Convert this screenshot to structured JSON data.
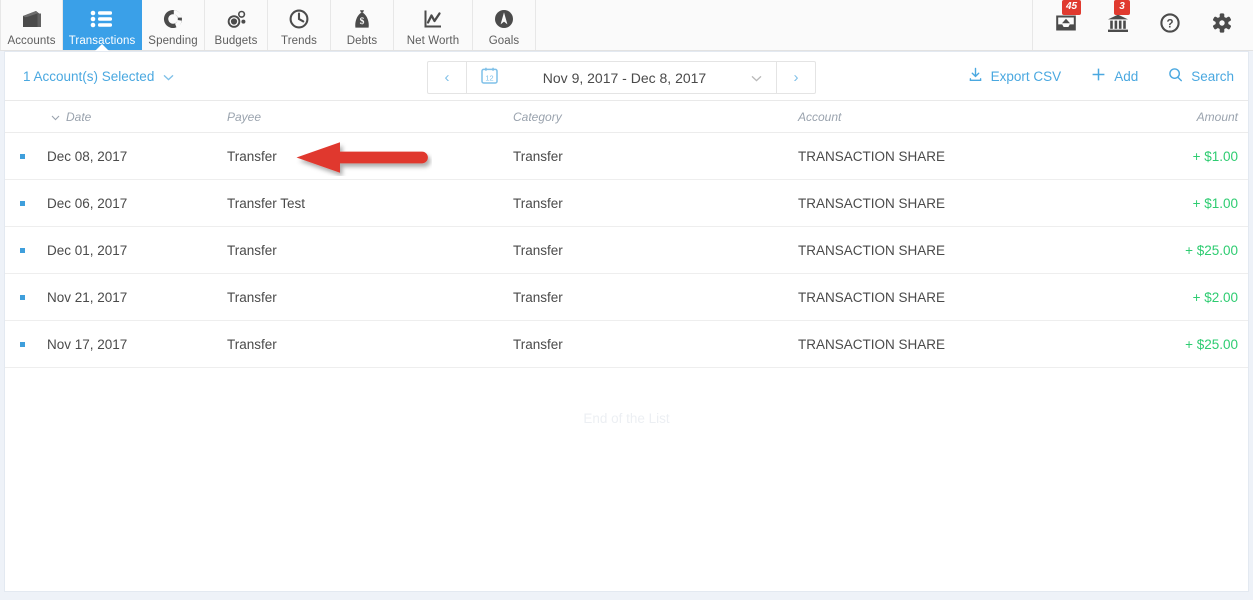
{
  "nav": {
    "tabs": [
      {
        "label": "Accounts",
        "icon": "wallet-icon",
        "active": false
      },
      {
        "label": "Transactions",
        "icon": "list-icon",
        "active": true
      },
      {
        "label": "Spending",
        "icon": "donut-chart-icon",
        "active": false
      },
      {
        "label": "Budgets",
        "icon": "bubbles-icon",
        "active": false
      },
      {
        "label": "Trends",
        "icon": "clock-icon",
        "active": false
      },
      {
        "label": "Debts",
        "icon": "money-bag-icon",
        "active": false
      },
      {
        "label": "Net Worth",
        "icon": "line-chart-icon",
        "active": false
      },
      {
        "label": "Goals",
        "icon": "compass-icon",
        "active": false
      }
    ],
    "actions": [
      {
        "name": "inbox-icon",
        "badge": "45"
      },
      {
        "name": "institution-icon",
        "badge": "3"
      },
      {
        "name": "help-icon",
        "badge": ""
      },
      {
        "name": "gear-icon",
        "badge": ""
      }
    ]
  },
  "toolbar": {
    "account_selector": "1 Account(s) Selected",
    "date_range": "Nov 9, 2017 - Dec 8, 2017",
    "calendar_day": "12",
    "prev_label": "‹",
    "next_label": "›",
    "export_label": "Export CSV",
    "add_label": "Add",
    "search_label": "Search"
  },
  "table": {
    "columns": {
      "date": "Date",
      "payee": "Payee",
      "category": "Category",
      "account": "Account",
      "amount": "Amount"
    },
    "rows": [
      {
        "date": "Dec 08, 2017",
        "payee": "Transfer",
        "category": "Transfer",
        "account": "TRANSACTION SHARE",
        "amount": "+ $1.00"
      },
      {
        "date": "Dec 06, 2017",
        "payee": "Transfer Test",
        "category": "Transfer",
        "account": "TRANSACTION SHARE",
        "amount": "+ $1.00"
      },
      {
        "date": "Dec 01, 2017",
        "payee": "Transfer",
        "category": "Transfer",
        "account": "TRANSACTION SHARE",
        "amount": "+ $25.00"
      },
      {
        "date": "Nov 21, 2017",
        "payee": "Transfer",
        "category": "Transfer",
        "account": "TRANSACTION SHARE",
        "amount": "+ $2.00"
      },
      {
        "date": "Nov 17, 2017",
        "payee": "Transfer",
        "category": "Transfer",
        "account": "TRANSACTION SHARE",
        "amount": "+ $25.00"
      }
    ],
    "end_of_list": "End of the List"
  },
  "annotation": {
    "type": "left-arrow",
    "color": "#e0392e",
    "points_at": "payee-cell-row-1"
  },
  "colors": {
    "accent_blue": "#3aa0e8",
    "link_blue": "#4aa8e0",
    "amount_green": "#2ecc71",
    "badge_red": "#e03a2f",
    "annotation_red": "#e0392e"
  }
}
